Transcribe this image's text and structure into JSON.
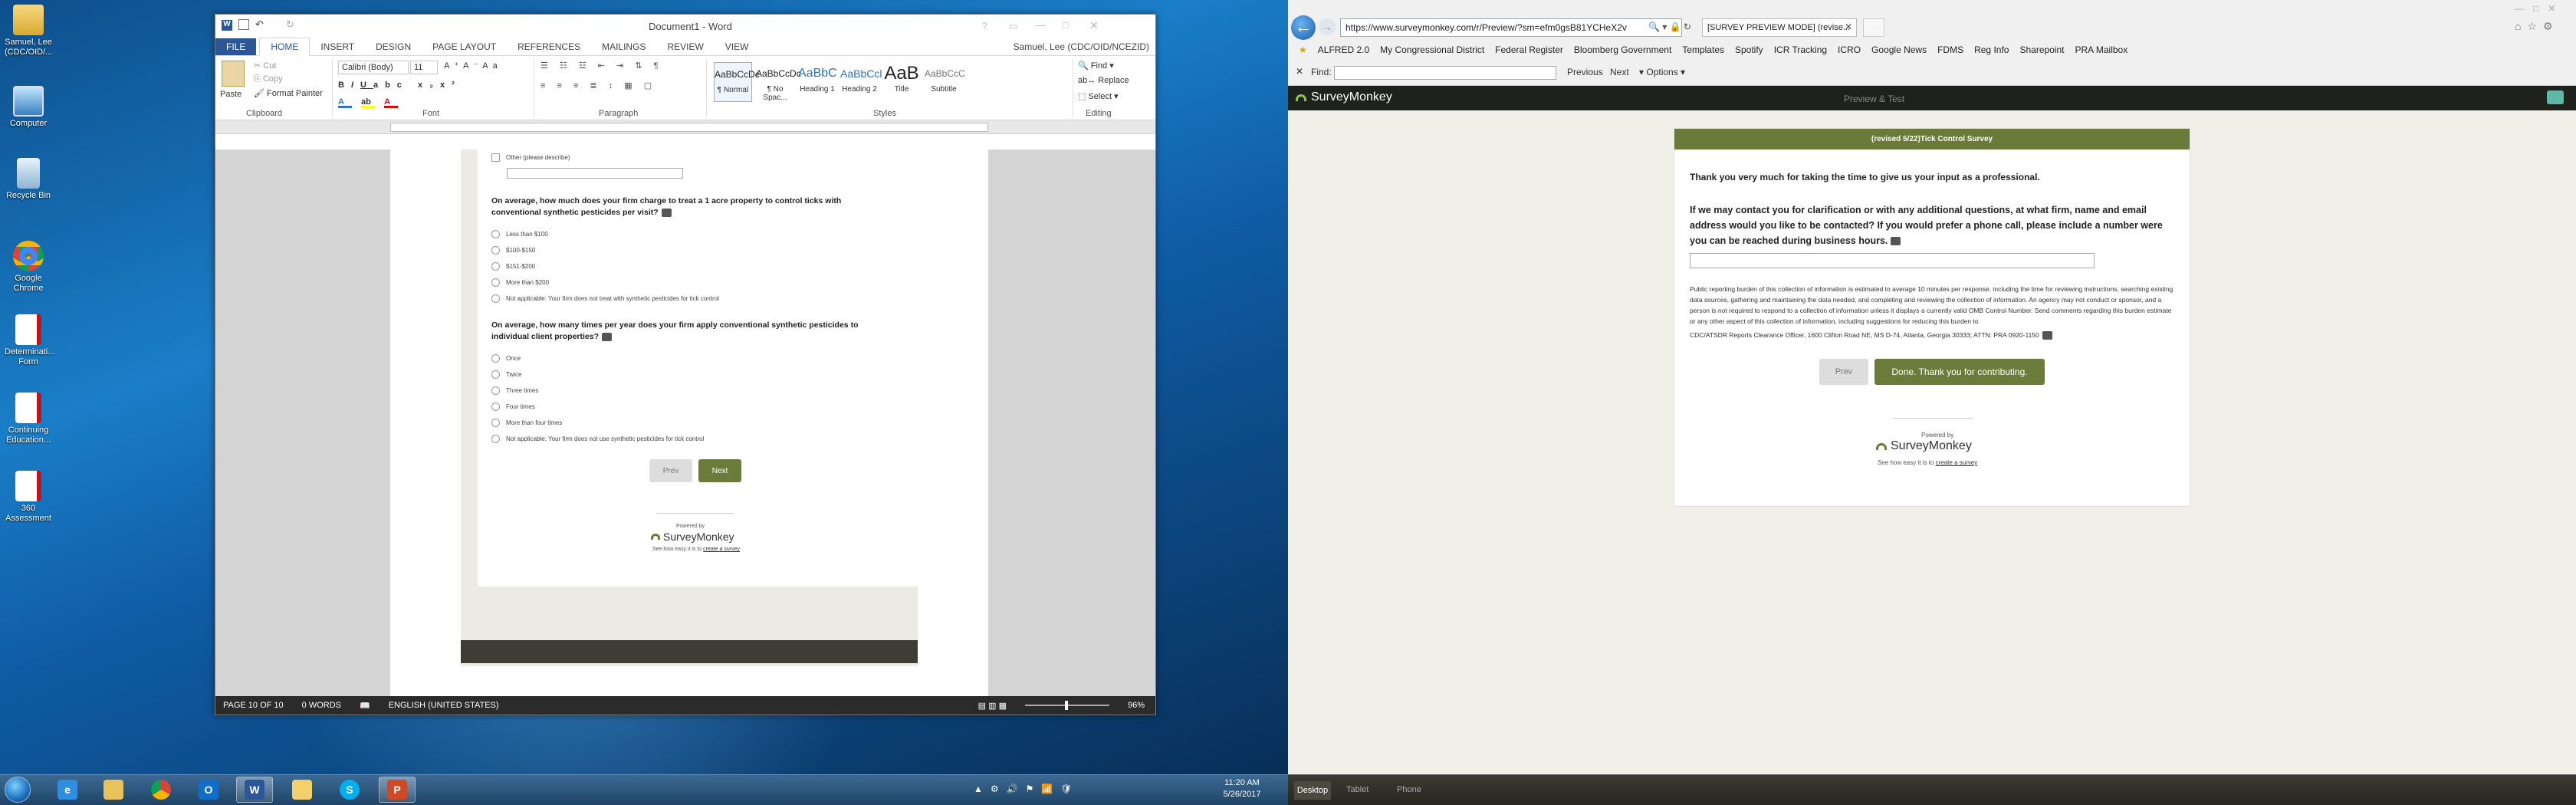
{
  "desktop": {
    "icons": [
      {
        "label": "Samuel, Lee (CDC/OID/...",
        "icon": "user-folder-icon"
      },
      {
        "label": "Computer",
        "icon": "computer-icon"
      },
      {
        "label": "Recycle Bin",
        "icon": "recycle-bin-icon"
      },
      {
        "label": "Google Chrome",
        "icon": "chrome-icon"
      },
      {
        "label": "Determinati... Form",
        "icon": "pdf-icon"
      },
      {
        "label": "Continuing Education...",
        "icon": "pdf-icon"
      },
      {
        "label": "360 Assessment",
        "icon": "pdf-icon"
      }
    ]
  },
  "word": {
    "title": "Document1 - Word",
    "user": "Samuel, Lee (CDC/OID/NCEZID)",
    "tabs": [
      "FILE",
      "HOME",
      "INSERT",
      "DESIGN",
      "PAGE LAYOUT",
      "REFERENCES",
      "MAILINGS",
      "REVIEW",
      "VIEW"
    ],
    "clipboard": {
      "paste": "Paste",
      "cut": "Cut",
      "copy": "Copy",
      "format_painter": "Format Painter",
      "group": "Clipboard"
    },
    "font": {
      "name": "Calibri (Body)",
      "size": "11",
      "group": "Font"
    },
    "paragraph_group": "Paragraph",
    "styles": [
      {
        "preview": "AaBbCcDc",
        "name": "¶ Normal"
      },
      {
        "preview": "AaBbCcDc",
        "name": "¶ No Spac..."
      },
      {
        "preview": "AaBbC",
        "name": "Heading 1"
      },
      {
        "preview": "AaBbCcl",
        "name": "Heading 2"
      },
      {
        "preview": "AaB",
        "name": "Title"
      },
      {
        "preview": "AaBbCcC",
        "name": "Subtitle"
      }
    ],
    "styles_group": "Styles",
    "editing": {
      "find": "Find",
      "replace": "Replace",
      "select": "Select",
      "group": "Editing"
    },
    "doc": {
      "other_label": "Other (please describe)",
      "q1": "On average, how much does your firm charge to treat a 1 acre property to control ticks with conventional synthetic pesticides per visit?",
      "q1_options": [
        "Less than $100",
        "$100-$150",
        "$151-$200",
        "More than $200",
        "Not applicable: Your firm does not treat with synthetic pesticides for tick control"
      ],
      "q2": "On average, how many times per year does your firm apply conventional synthetic pesticides to individual client properties?",
      "q2_options": [
        "Once",
        "Twice",
        "Three times",
        "Four times",
        "More than four times",
        "Not applicable: Your firm does not use synthetic pesticides for tick control"
      ],
      "prev": "Prev",
      "next": "Next",
      "powered": "Powered by",
      "brand": "SurveyMonkey",
      "see_how": "See how easy it is to",
      "create": "create a survey"
    },
    "status": {
      "page": "PAGE 10 OF 10",
      "words": "0 WORDS",
      "lang": "ENGLISH (UNITED STATES)",
      "zoom": "96%"
    }
  },
  "ie": {
    "url": "https://www.surveymonkey.com/r/Preview/?sm=efm0gsB81YCHeX2v",
    "tab_title": "[SURVEY PREVIEW MODE] (revise...",
    "favorites": [
      "ALFRED 2.0",
      "My Congressional District",
      "Federal Register",
      "Bloomberg Government",
      "Templates",
      "Spotify",
      "ICR Tracking",
      "ICRO",
      "Google News",
      "FDMS",
      "Reg Info",
      "Sharepoint",
      "PRA Mailbox"
    ],
    "find_label": "Find:",
    "find_prev": "Previous",
    "find_next": "Next",
    "find_options": "Options"
  },
  "sm": {
    "logo": "SurveyMonkey",
    "preview_test": "Preview & Test",
    "survey_title": "(revised 5/22)Tick Control Survey",
    "thanks": "Thank you very much for taking the time to give us your input as a professional.",
    "question": "If we may contact you for clarification or with any additional questions, at what firm, name and email address would you like to be contacted? If you would prefer a phone call, please include a number were you can be reached during business hours.",
    "burden": "Public reporting burden of this collection of information is estimated to average 10 minutes per response, including the time for reviewing instructions, searching existing data sources, gathering and maintaining the data needed, and completing and reviewing the collection of information. An agency may not conduct or sponsor, and a person is not required to respond to a collection of information unless it displays a currently valid OMB Control Number. Send comments regarding this burden estimate or any other aspect of this collection of information, including suggestions for reducing this burden to",
    "address": "CDC/ATSDR Reports Clearance Officer, 1600 Clifton Road NE, MS D-74, Atlanta, Georgia 30333; ATTN: PRA 0920-1150",
    "prev": "Prev",
    "done": "Done. Thank you for contributing.",
    "powered": "Powered by",
    "see_how": "See how easy it is to",
    "create": "create a survey",
    "footer_tabs": [
      "Desktop",
      "Tablet",
      "Phone"
    ]
  },
  "taskbar": {
    "time": "11:20 AM",
    "date": "5/26/2017"
  },
  "colors": {
    "sm_green": "#6b7b3a",
    "word_blue": "#2b579a"
  }
}
